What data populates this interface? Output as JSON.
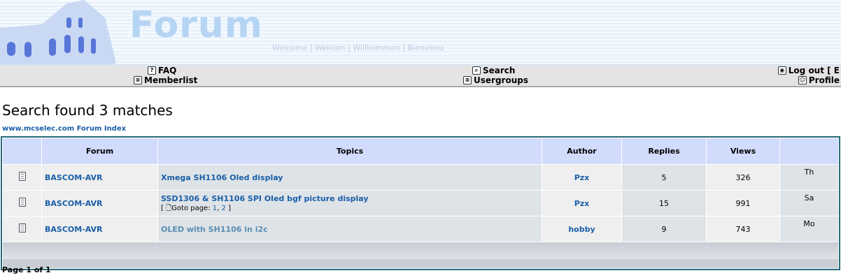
{
  "header": {
    "logo_text": "Forum",
    "welcome": "Welcome | Welkom | Willkommen | Bienvenu"
  },
  "nav": {
    "faq": {
      "label": "FAQ",
      "icon": "help-icon"
    },
    "memberlist": {
      "label": "Memberlist",
      "icon": "list-icon"
    },
    "search": {
      "label": "Search",
      "icon": "search-icon"
    },
    "usergroups": {
      "label": "Usergroups",
      "icon": "groups-icon"
    },
    "logout": {
      "label": "Log out [ E",
      "icon": "logout-icon"
    },
    "profile": {
      "label": "Profile",
      "icon": "profile-icon"
    }
  },
  "page_title": "Search found 3 matches",
  "breadcrumb": "www.mcselec.com Forum Index",
  "table": {
    "headers": [
      "Forum",
      "Topics",
      "Author",
      "Replies",
      "Views"
    ],
    "rows": [
      {
        "forum": "BASCOM-AVR",
        "topic": "Xmega SH1106 Oled display",
        "author": "Pzx",
        "replies": "5",
        "views": "326",
        "last": "Th"
      },
      {
        "forum": "BASCOM-AVR",
        "topic": "SSD1306 & SH1106 SPI Oled bgf picture display",
        "goto_prefix": "[",
        "goto_label": "Goto page:",
        "page1": "1",
        "sep": ",",
        "page2": "2",
        "goto_suffix": "]",
        "author": "Pzx",
        "replies": "15",
        "views": "991",
        "last": "Sa"
      },
      {
        "forum": "BASCOM-AVR",
        "topic": "OLED with SH1106 in i2c",
        "author": "hobby",
        "replies": "9",
        "views": "743",
        "last": "Mo"
      }
    ]
  },
  "pagination": "Page 1 of 1"
}
